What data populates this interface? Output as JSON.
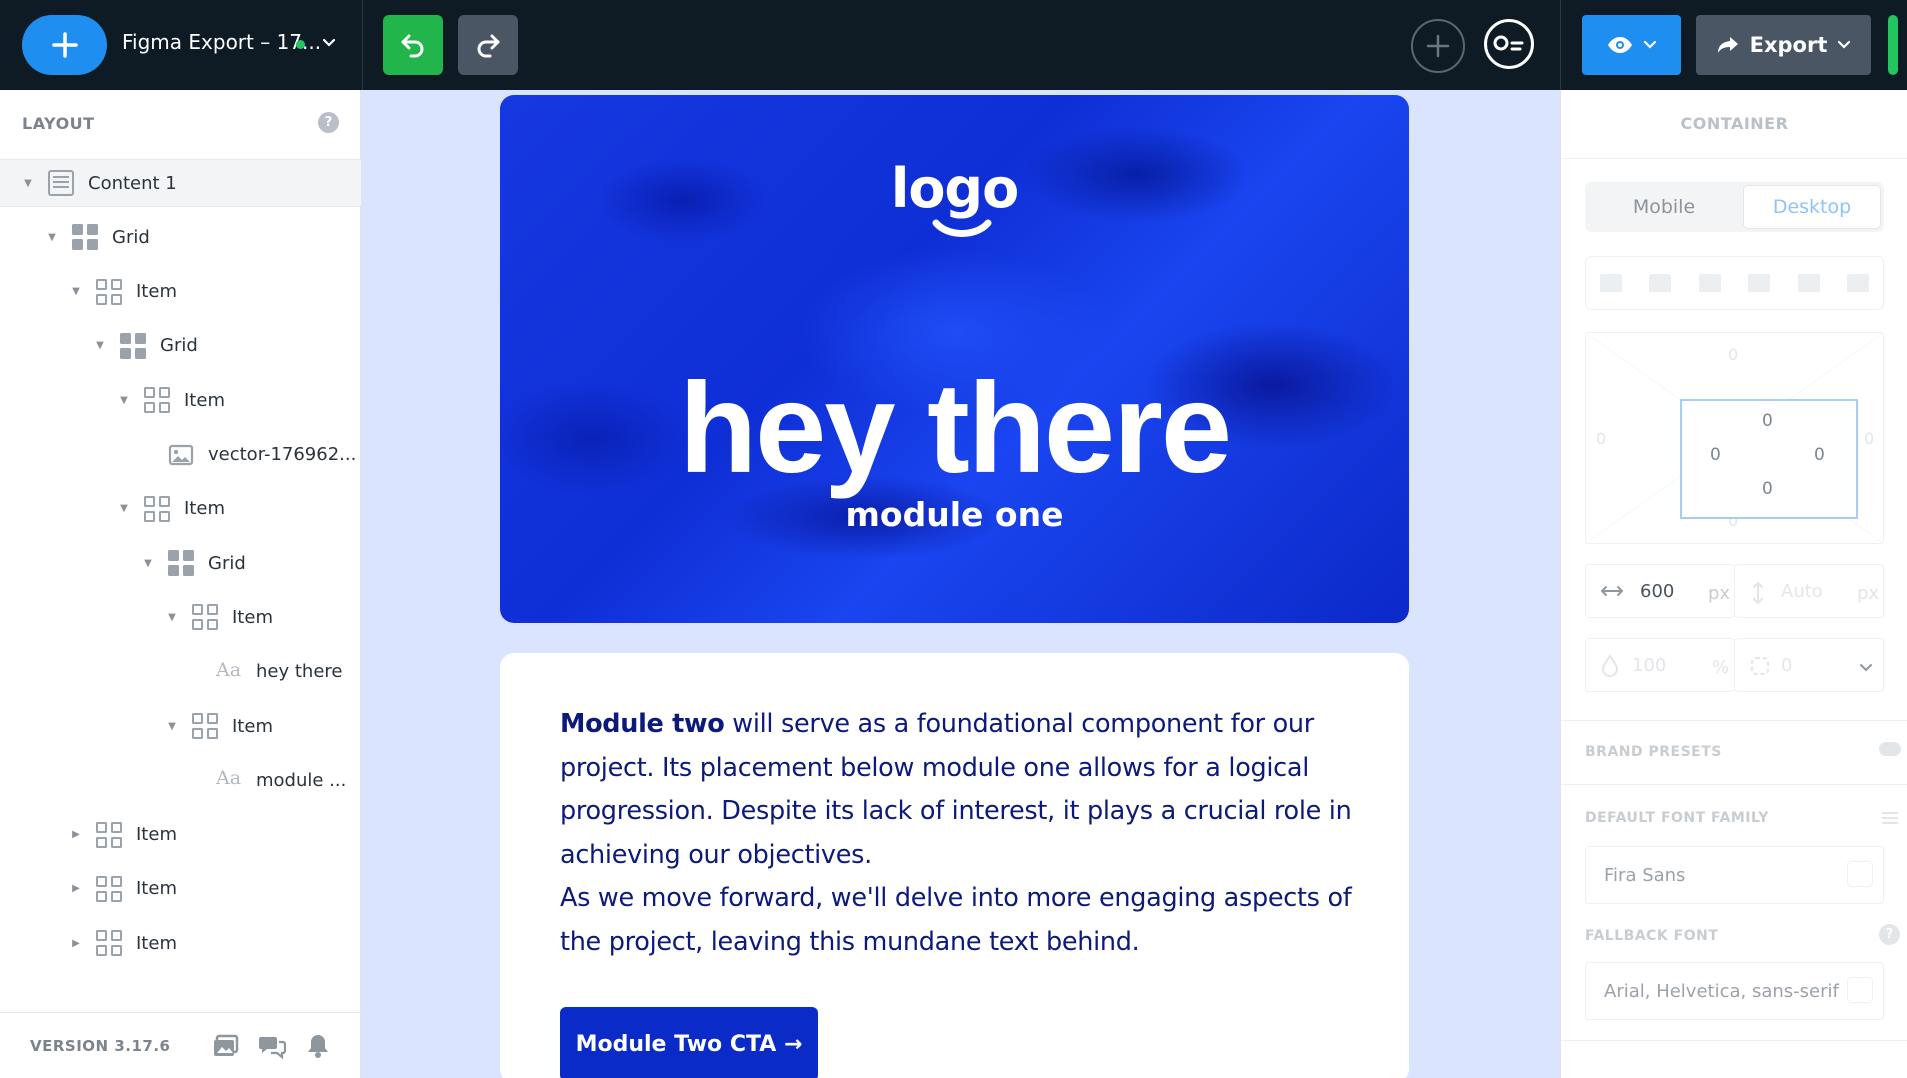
{
  "topbar": {
    "doc_title": "Figma Export – 17...",
    "export_label": "Export"
  },
  "layout_panel": {
    "title": "LAYOUT",
    "help": "?",
    "tree": [
      {
        "label": "Content 1",
        "type": "content",
        "depth": 0,
        "expanded": true
      },
      {
        "label": "Grid",
        "type": "grid",
        "depth": 1,
        "expanded": true
      },
      {
        "label": "Item",
        "type": "item",
        "depth": 2,
        "expanded": true
      },
      {
        "label": "Grid",
        "type": "grid",
        "depth": 3,
        "expanded": true
      },
      {
        "label": "Item",
        "type": "item",
        "depth": 4,
        "expanded": true
      },
      {
        "label": "vector-176962...",
        "type": "image",
        "depth": 5
      },
      {
        "label": "Item",
        "type": "item",
        "depth": 4,
        "expanded": true
      },
      {
        "label": "Grid",
        "type": "grid",
        "depth": 5,
        "expanded": true
      },
      {
        "label": "Item",
        "type": "item",
        "depth": 6,
        "expanded": true
      },
      {
        "label": "hey there",
        "type": "text",
        "depth": 7
      },
      {
        "label": "Item",
        "type": "item",
        "depth": 6,
        "expanded": true
      },
      {
        "label": "module ...",
        "type": "text",
        "depth": 7
      },
      {
        "label": "Item",
        "type": "item",
        "depth": 2,
        "expanded": false
      },
      {
        "label": "Item",
        "type": "item",
        "depth": 2,
        "expanded": false
      },
      {
        "label": "Item",
        "type": "item",
        "depth": 2,
        "expanded": false
      }
    ],
    "version": "VERSION 3.17.6"
  },
  "canvas": {
    "hero": {
      "logo": "logo",
      "title": "hey there",
      "subtitle": "module one"
    },
    "module_two": {
      "bold_lead": "Module two",
      "paragraph_1": " will serve as a foundational component for our project. Its placement below module one allows for a logical progression. Despite its lack of interest, it plays a crucial role in achieving our objectives.",
      "paragraph_2": "As we move forward, we'll delve into more engaging aspects of the project, leaving this mundane text behind.",
      "cta_label": "Module Two CTA →"
    }
  },
  "container_panel": {
    "title": "CONTAINER",
    "tabs": [
      "Mobile",
      "Desktop"
    ],
    "active_tab": "Desktop",
    "margin": {
      "top": "0",
      "right": "0",
      "bottom": "0",
      "left": "0"
    },
    "padding": {
      "top": "0",
      "right": "0",
      "bottom": "0",
      "left": "0"
    },
    "width_value": "600",
    "width_unit": "px",
    "height_value": "Auto",
    "height_unit": "px",
    "opacity_value": "100",
    "opacity_unit": "%",
    "radius_value": "0",
    "brand_presets_label": "BRAND PRESETS",
    "default_font_label": "DEFAULT FONT FAMILY",
    "default_font_value": "Fira Sans",
    "fallback_font_label": "FALLBACK FONT",
    "fallback_font_value": "Arial, Helvetica, sans-serif",
    "help": "?"
  },
  "colors": {
    "topbar_bg": "#0f1b24",
    "primary_blue": "#1f8ef1",
    "success_green": "#22b54b",
    "canvas_bg": "#dbe4ff",
    "hero_blue": "#1638e0",
    "cta_blue": "#0a2bc7",
    "body_text": "#0c1a7a"
  }
}
